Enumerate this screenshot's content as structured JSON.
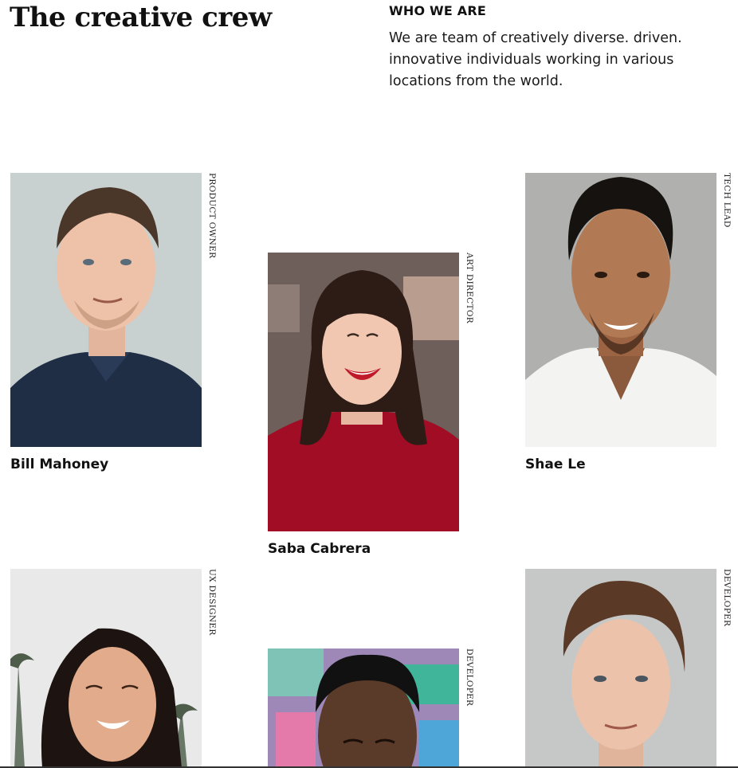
{
  "header": {
    "title": "The creative crew",
    "who_heading": "WHO WE ARE",
    "who_text": "We are team of creatively diverse. driven. innovative individuals working in various locations from the world."
  },
  "team": [
    {
      "name": "Bill Mahoney",
      "role": "PRODUCT OWNER"
    },
    {
      "name": "Saba Cabrera",
      "role": "ART DIRECTOR"
    },
    {
      "name": "Shae Le",
      "role": "TECH LEAD"
    },
    {
      "name": "",
      "role": "UX DESIGNER"
    },
    {
      "name": "",
      "role": "DEVELOPER"
    },
    {
      "name": "",
      "role": "DEVELOPER"
    }
  ]
}
